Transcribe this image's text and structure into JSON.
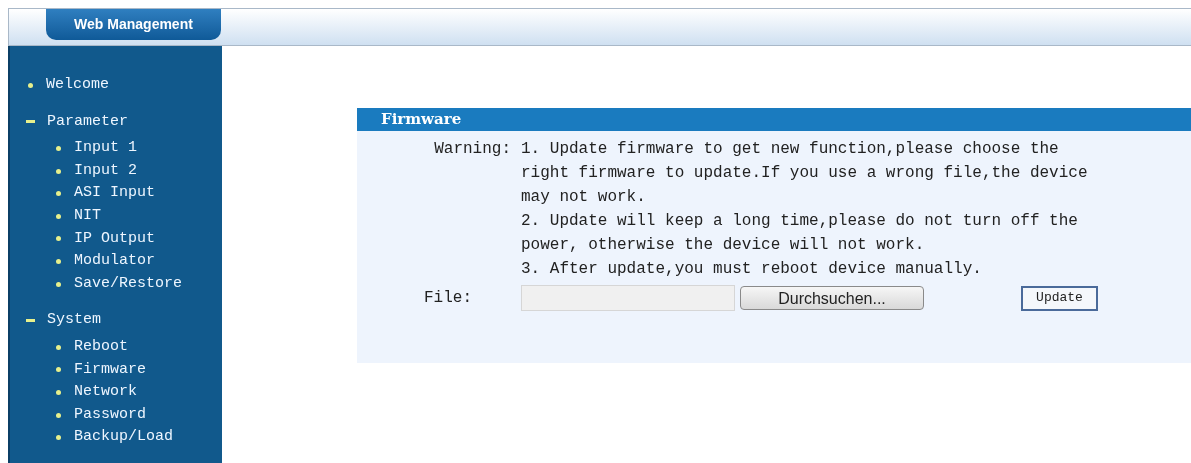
{
  "header": {
    "title": "Web Management"
  },
  "sidebar": {
    "items": [
      {
        "kind": "link",
        "label": "Welcome"
      },
      {
        "kind": "group",
        "label": "Parameter",
        "expanded": true,
        "children": [
          {
            "kind": "link",
            "label": "Input 1"
          },
          {
            "kind": "link",
            "label": "Input 2"
          },
          {
            "kind": "link",
            "label": "ASI Input"
          },
          {
            "kind": "link",
            "label": "NIT"
          },
          {
            "kind": "link",
            "label": "IP Output"
          },
          {
            "kind": "link",
            "label": "Modulator"
          },
          {
            "kind": "link",
            "label": "Save/Restore"
          }
        ]
      },
      {
        "kind": "group",
        "label": "System",
        "expanded": true,
        "children": [
          {
            "kind": "link",
            "label": "Reboot"
          },
          {
            "kind": "link",
            "label": "Firmware"
          },
          {
            "kind": "link",
            "label": "Network"
          },
          {
            "kind": "link",
            "label": "Password"
          },
          {
            "kind": "link",
            "label": "Backup/Load"
          }
        ]
      }
    ]
  },
  "panel": {
    "title": "Firmware",
    "warning_label": "Warning:",
    "warning_lines": [
      "1. Update firmware to get new function,please choose the",
      "right firmware to update.If you use a wrong file,the device",
      "may not work.",
      "2. Update will keep a long time,please do not turn off the",
      "power, otherwise the device will not work.",
      "3. After update,you must reboot device manually."
    ],
    "file_label": "File:",
    "browse_button": "Durchsuchen...",
    "update_button": "Update"
  }
}
